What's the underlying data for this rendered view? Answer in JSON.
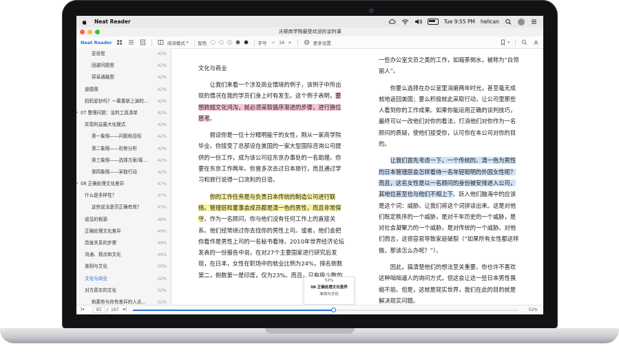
{
  "menubar": {
    "app_name": "Neat Reader",
    "clock": "Tue 9:55 PM",
    "user": "hellcan"
  },
  "window": {
    "title": "沃顿商学院最受欢迎的谈判课"
  },
  "toolbar": {
    "brand": "Neat Reader",
    "read_mode": "阅读模式",
    "color_label": "配色",
    "font_label": "字号",
    "font_size": "16",
    "more_settings": "更多设置"
  },
  "colors": {
    "accent": "#2a6fd6",
    "highlight_pink": "#f8c9d4",
    "highlight_yellow": "#fbf3a0",
    "highlight_blue": "#cfe1f7",
    "swatches": [
      "#ffffff",
      "#f6f3e7",
      "#e2efe0",
      "#555555",
      "#222222"
    ]
  },
  "toc": [
    {
      "label": "妥协型",
      "pct": "42%",
      "level": 3
    },
    {
      "label": "回避问题型",
      "pct": "42%",
      "level": 3
    },
    {
      "label": "容易通融型",
      "pct": "42%",
      "level": 3
    },
    {
      "label": "道德观",
      "pct": "42%",
      "level": 1
    },
    {
      "label": "妈妈爱钞吗？一幕重新上演的...",
      "pct": "42%",
      "level": 1
    },
    {
      "label": "07 整理问题：谈判工具清单",
      "pct": "42%",
      "level": 0
    },
    {
      "label": "实现利益最大化模式",
      "pct": "42%",
      "level": 1
    },
    {
      "label": "第一象限——问题和目标",
      "pct": "42%",
      "level": 2
    },
    {
      "label": "第二象限——形势分析",
      "pct": "42%",
      "level": 2
    },
    {
      "label": "第三象限——选择方案/筹...",
      "pct": "42%",
      "level": 2
    },
    {
      "label": "第四象限——采取行动",
      "pct": "42%",
      "level": 2
    },
    {
      "label": "08 正确处理文化差异",
      "pct": "47%",
      "level": 0
    },
    {
      "label": "什么是多样性？",
      "pct": "47%",
      "level": 1
    },
    {
      "label": "这些说法是否正确有效？",
      "pct": "47%",
      "level": 2
    },
    {
      "label": "成见的根源",
      "pct": "48%",
      "level": 1
    },
    {
      "label": "正确处理文化差异",
      "pct": "49%",
      "level": 1
    },
    {
      "label": "改善关系的步骤",
      "pct": "49%",
      "level": 1
    },
    {
      "label": "沟通、观点和文化",
      "pct": "49%",
      "level": 1
    },
    {
      "label": "准则与文化",
      "pct": "50%",
      "level": 1
    },
    {
      "label": "文化与商业",
      "pct": "52%",
      "level": 1,
      "active": true
    },
    {
      "label": "对方真实的文化",
      "pct": "52%",
      "level": 1
    },
    {
      "label": "和那些与你有差异的人达...",
      "pct": "52%",
      "level": 2
    }
  ],
  "content": {
    "chapter_title": "文化与商业",
    "left": {
      "p1a": "让我们来看一个涉及商业情境的例子，该例子中所出现的情况在我的学员们身上时有发生。这个例子表明，",
      "p1_hl": "要想跨越文化鸿沟，就必须采取循序渐进的步骤，进行换位思考",
      "p1b": "。",
      "p2": "假设你是一位十分精明能干的女性，刚从一家商学院毕业。你接受了总部设在美国的一家大型国际咨询公司提供的一份工作，成为该公司驻东京办事处的一名助理。你要在东京工作两年。你曾多次去过日本旅行，而且通过学习和旅行说得一口流利的日语。",
      "p3_hl": "你的工作任务是与负责日本传统的制造公司进行联络。管理层和董事会成员都是清一色的男性，而且非常保守",
      "p3b": "。作为一名顾问，你与他们没有任何工作上的直接关系。他们经常绕过你去找你的男性上司。或者，他们会把你看作是男性上司的一名秘书看待。2010年世界经济论坛发表的一份报告中说，在对27个主要国家进行研究后发现，在日本，女性在职场中的就业比例为24%，排名倒数第二，倒数第一是印度，仅为23%。而且，只有极少数的女性能被推进入公司的高层。在日本的劳动力大军中，进入公司高层的女性比例..."
    },
    "right": {
      "p0": "一些办公室文员之类的工作，如端茶倒水，被称为“白领丽人”。",
      "p1": "你要么选择在办公室里消磨两年时光，甚至毫无成就地返回美国；要么积极就此采取行动，让公司里那些人看到你的工作成果。如果你能运用正确的谈判技巧，最终可以一改他们对你的看法，打消他们对你作为一名顾问的质疑，使他们接受你，认可你在本公司对你的目的。",
      "p2_hl": "让我们首先考虑一下，一个传统的、清一色为男性的日本管理层会怎样看待一名年轻聪明的外国女性呢？而且，这名女性是以一名顾问的身份被安排进入公司，其地位甚至也与他们不相上下",
      "p2b": "。跃入他们脑海中的应该是这个词：威胁。让我们将这个词拼读出来。这是对他们既定秩序的一个威胁，是对千年历史的一个威胁，是对社会凝聚力的一个威胁，是对传统的一个威胁。对他们而言，这很容易导致家庭破裂（“如果所有女性都这样做，那该怎么办呢？”）。",
      "p3": "因此，搞清楚他们的想法至关重要。你也许不喜欢这种咄咄逼人的询问方式，但这会让这一些日本男性畏缩不前。但是，这就是现实世界，我们在此的目的就是解决现实问题。"
    }
  },
  "tooltip": {
    "pct": "52%",
    "chapter": "08 正确处理文化差异",
    "section": "准则与文化"
  },
  "footer": {
    "page_current": "81",
    "page_total": "167",
    "percent": "52%",
    "progress": 0.52
  }
}
